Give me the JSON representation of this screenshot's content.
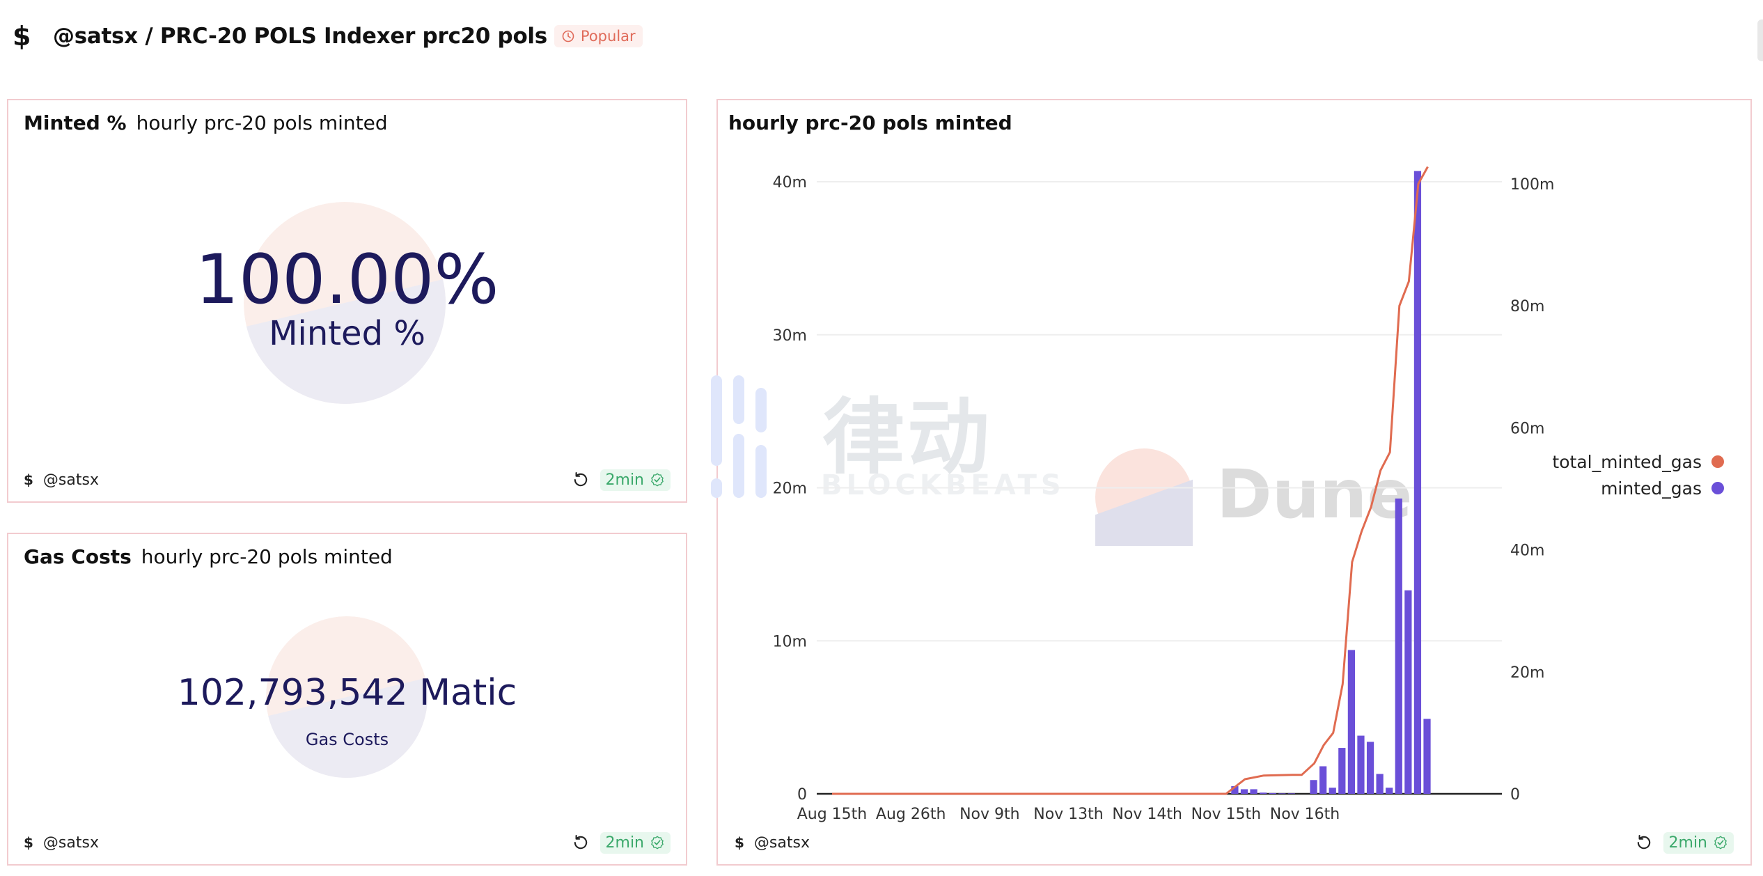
{
  "header": {
    "icon": "dollar-sign-icon",
    "title": "@satsx / PRC-20 POLS Indexer prc20 pols",
    "badge": "Popular",
    "badge_icon": "clock-icon"
  },
  "colors": {
    "panel_border": "#f2cbcf",
    "counter_text": "#1d1a5c",
    "bar": "#6a4fd8",
    "line": "#e06b50",
    "badge_bg": "#e8f7ee",
    "badge_text": "#3aa86a",
    "popular_text": "#e06b5a"
  },
  "panels": {
    "minted": {
      "name": "Minted %",
      "subtitle": "hourly prc-20 pols minted",
      "value": "100.00%",
      "label": "Minted %",
      "owner": "@satsx",
      "refresh_age": "2min"
    },
    "gas": {
      "name": "Gas Costs",
      "subtitle": "hourly prc-20 pols minted",
      "value": "102,793,542 Matic",
      "label": "Gas Costs",
      "owner": "@satsx",
      "refresh_age": "2min"
    },
    "chart": {
      "title": "hourly prc-20 pols minted",
      "owner": "@satsx",
      "refresh_age": "2min"
    }
  },
  "watermarks": {
    "blockbeats_cn": "律动",
    "blockbeats_en": "BLOCKBEATS",
    "dune": "Dune"
  },
  "chart_data": {
    "type": "bar+line",
    "title": "hourly prc-20 pols minted",
    "xlabel": "",
    "categories": [
      "Aug 15th",
      "Aug 26th",
      "Nov 9th",
      "Nov 13th",
      "Nov 14th",
      "Nov 15th",
      "Nov 16th"
    ],
    "left_axis": {
      "ticks": [
        "0",
        "10m",
        "20m",
        "30m",
        "40m"
      ],
      "ylim": [
        0,
        40000000
      ]
    },
    "right_axis": {
      "ticks": [
        "0",
        "20m",
        "40m",
        "60m",
        "80m",
        "100m"
      ],
      "ylim": [
        0,
        100000000
      ]
    },
    "grid": true,
    "legend_position": "right",
    "series": [
      {
        "name": "minted_gas",
        "type": "bar",
        "axis": "left",
        "color": "#6a4fd8",
        "x_index": [
          0,
          0.5,
          1,
          1.5,
          2,
          2.5,
          3,
          3.5,
          4,
          4.5,
          5,
          5.12,
          5.24,
          5.36,
          5.48,
          5.6,
          5.72,
          5.84,
          5.96,
          6.0,
          6.12,
          6.24,
          6.36,
          6.48,
          6.6,
          6.72,
          6.84,
          6.96,
          7.08,
          7.2,
          7.32,
          7.44,
          7.56,
          7.68,
          7.8
        ],
        "values": [
          0,
          0,
          0,
          0,
          0,
          0,
          0,
          0,
          0,
          0,
          0,
          500000,
          300000,
          300000,
          80000,
          50000,
          30000,
          30000,
          0,
          0,
          900000,
          1800000,
          400000,
          3000000,
          9400000,
          3800000,
          3400000,
          1300000,
          400000,
          19300000,
          13300000,
          40700000,
          4900000,
          0,
          0
        ]
      },
      {
        "name": "total_minted_gas",
        "type": "line",
        "axis": "right",
        "color": "#e06b50",
        "x_index": [
          0,
          1,
          2,
          3,
          4,
          5,
          5.12,
          5.24,
          5.48,
          5.84,
          5.96,
          6.12,
          6.24,
          6.36,
          6.48,
          6.6,
          6.72,
          6.84,
          6.96,
          7.08,
          7.2,
          7.32,
          7.44,
          7.56
        ],
        "values": [
          0,
          0,
          0,
          0,
          0,
          0,
          1200000,
          2400000,
          3000000,
          3100000,
          3100000,
          5000000,
          8000000,
          10000000,
          18000000,
          38000000,
          43000000,
          47000000,
          53000000,
          56000000,
          80000000,
          84000000,
          100000000,
          102793542
        ]
      }
    ]
  }
}
